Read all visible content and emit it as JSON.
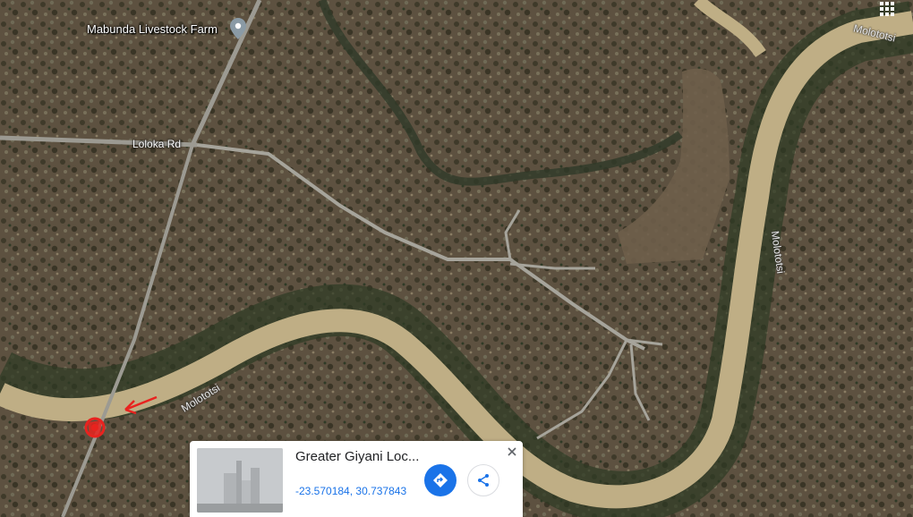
{
  "map": {
    "type": "satellite",
    "place_label": "Mabunda Livestock Farm",
    "road_label": "Loloka Rd",
    "river_labels": [
      "Molototsi",
      "Molototsi",
      "Molototsi"
    ],
    "pin_icon": "location-pin-icon",
    "apps_icon": "apps-grid-icon",
    "marker_color": "#e8231f"
  },
  "place_card": {
    "title": "Greater Giyani Loc...",
    "coordinates": "-23.570184, 30.737843",
    "directions_icon": "directions-icon",
    "share_icon": "share-icon",
    "close_icon": "close-icon",
    "accent": "#1a73e8"
  }
}
